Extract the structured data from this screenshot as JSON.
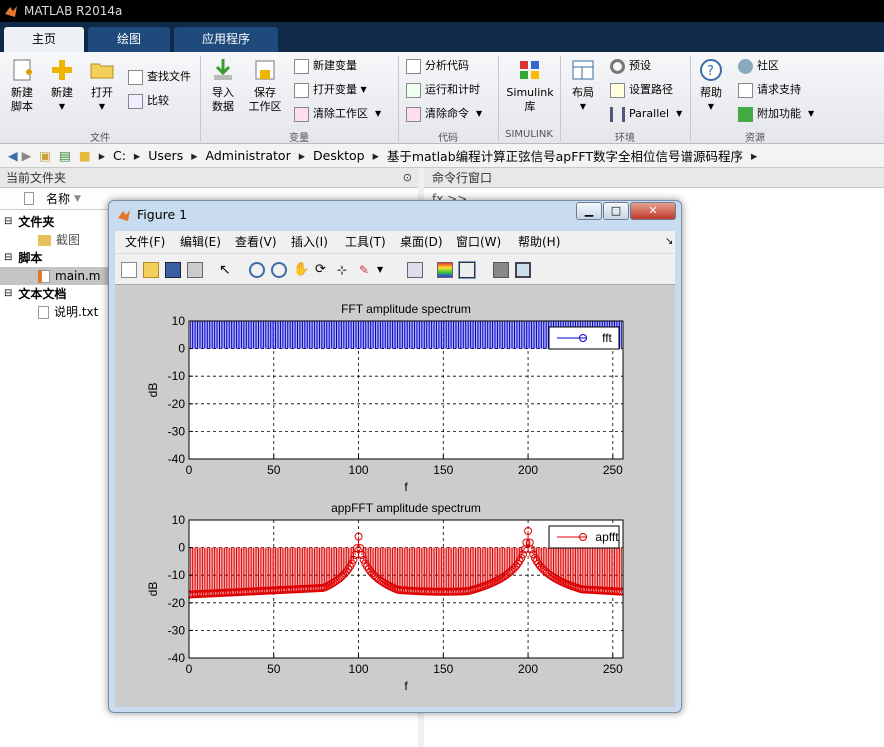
{
  "window": {
    "title": "MATLAB R2014a"
  },
  "tabs": [
    {
      "label": "主页"
    },
    {
      "label": "绘图"
    },
    {
      "label": "应用程序"
    }
  ],
  "ribbon": {
    "file": {
      "new_script": "新建\n脚本",
      "new": "新建",
      "open": "打开",
      "find_files": "查找文件",
      "compare": "比较",
      "group": "文件"
    },
    "variable": {
      "import": "导入\n数据",
      "save_ws": "保存\n工作区",
      "new_var": "新建变量",
      "open_var": "打开变量",
      "clear_ws": "清除工作区",
      "group": "变量"
    },
    "code": {
      "analyze": "分析代码",
      "run_time": "运行和计时",
      "clear_cmd": "清除命令",
      "group": "代码"
    },
    "simulink": {
      "lib": "Simulink\n库",
      "group": "SIMULINK"
    },
    "env": {
      "layout": "布局",
      "prefs": "预设",
      "set_path": "设置路径",
      "parallel": "Parallel",
      "group": "环境"
    },
    "resources": {
      "help": "帮助",
      "community": "社区",
      "request": "请求支持",
      "addons": "附加功能",
      "group": "资源"
    }
  },
  "address": {
    "path": [
      "C:",
      "Users",
      "Administrator",
      "Desktop",
      "基于matlab编程计算正弦信号apFFT数字全相位信号谱源码程序"
    ]
  },
  "left_panel": {
    "title": "当前文件夹",
    "col_name": "名称",
    "groups": [
      {
        "label": "文件夹",
        "items": [
          "截图"
        ]
      },
      {
        "label": "脚本",
        "items": [
          "main.m"
        ]
      },
      {
        "label": "文本文档",
        "items": [
          "说明.txt"
        ]
      }
    ]
  },
  "cmd": {
    "title": "命令行窗口",
    "prompt": "fx >>"
  },
  "figure": {
    "title": "Figure 1",
    "menu": [
      "文件(F)",
      "编辑(E)",
      "查看(V)",
      "插入(I)",
      "工具(T)",
      "桌面(D)",
      "窗口(W)",
      "帮助(H)"
    ]
  },
  "chart_data": [
    {
      "type": "bar",
      "title": "FFT amplitude spectrum",
      "xlabel": "f",
      "ylabel": "dB",
      "xlim": [
        0,
        256
      ],
      "ylim": [
        -40,
        10
      ],
      "xticks": [
        0,
        50,
        100,
        150,
        200,
        250
      ],
      "yticks": [
        10,
        0,
        -10,
        -20,
        -30,
        -40
      ],
      "grid": true,
      "legend": "top-right",
      "series": [
        {
          "name": "fft",
          "color": "#0000cc",
          "marker": "o",
          "description_values": "stem at every integer bin 0..255, all values above top of axis (clipped at 10)"
        }
      ]
    },
    {
      "type": "bar",
      "title": "appFFT amplitude spectrum",
      "xlabel": "f",
      "ylabel": "dB",
      "xlim": [
        0,
        256
      ],
      "ylim": [
        -40,
        10
      ],
      "xticks": [
        0,
        50,
        100,
        150,
        200,
        250
      ],
      "yticks": [
        10,
        0,
        -10,
        -20,
        -30,
        -40
      ],
      "grid": true,
      "legend": "top-right",
      "series": [
        {
          "name": "apfft",
          "color": "#dd0000",
          "marker": "o",
          "peaks": [
            {
              "x": 100,
              "y": 4
            },
            {
              "x": 200,
              "y": 6
            }
          ],
          "baseline_min": -18
        }
      ]
    }
  ]
}
